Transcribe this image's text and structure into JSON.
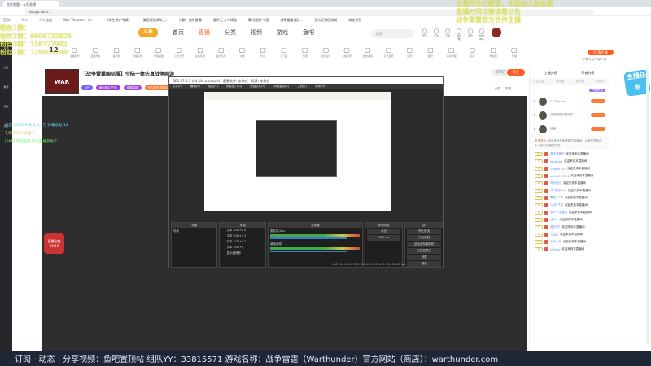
{
  "browser": {
    "tab_title": "战争雷霆 - 斗鱼直播",
    "url": "douyu.com/…",
    "bookmarks": [
      "百科",
      "个人",
      "人人法宝",
      "War Thunder - 六…",
      "《学生用户专属》",
      "美丽优质精华_…",
      "沐鹏 - 战争雷霆",
      "提供无·心中精品",
      "腾讯视频·中国",
      "战争雷霆战区…",
      "官方正宗国游戏",
      "其他书签"
    ]
  },
  "overlay": {
    "left_lines": [
      "粉丝1群：",
      "粉丝2群：6606725826",
      "粉丝3群：158327992",
      "粉丝1群：729803299"
    ],
    "right_lines": [
      "主播开车已解锁，欢迎加入粉丝群",
      "直播时间详情请看公告",
      "战争雷霆官方合作主播"
    ]
  },
  "leftbar": {
    "items": [
      "直播",
      "关注",
      "推荐",
      "游戏",
      "消息"
    ]
  },
  "nav": {
    "logo": "斗鱼",
    "items": [
      "首页",
      "直播",
      "分类",
      "视频",
      "游戏",
      "鱼吧"
    ],
    "search_placeholder": "搜索",
    "top_icons": [
      "历史",
      "关注",
      "下载",
      "客户端",
      "消息",
      "创作中心"
    ]
  },
  "iconrow": {
    "count": "12",
    "items": [
      "主播积分",
      "直播开关",
      "鱼乐圈",
      "主播任务",
      "开播提醒",
      "火力全开",
      "鲨鱼任务",
      "官方任务",
      "礼物",
      "分享",
      "小飞船",
      "乐团",
      "主播任务",
      "主播之家",
      "回放视频",
      "打赏金币",
      "房管",
      "超管",
      "房间管理",
      "互动",
      "粉丝团",
      "开播",
      "更多"
    ],
    "pc_button": "PC客户端",
    "pc_sub": "下载斗鱼PC客户端"
  },
  "stream": {
    "title": "【战争雷霆国际服】空陆一体仿真战争网游",
    "thumb": "WAR THUNDER",
    "tags": [
      "VIP",
      "福利商店 豆券",
      "直播高能",
      "全民助攻 直播活动"
    ],
    "follow_count": "47.9万",
    "follow_label": "关注",
    "share": "分享",
    "report": "举报"
  },
  "stats": {
    "line1": "热度 129289   关注 4.7万   弹幕总数 18",
    "line2": "礼物 1939               贡献 0",
    "line3": "[SKP] 欢迎回来   您的直播开始了"
  },
  "gift": {
    "label": "直播宝箱",
    "count": "20/59"
  },
  "obs": {
    "title": "OBS 27.2.1 (64 bit, windows) - 配置文件: 未命名 - 场景: 未命名",
    "menu": [
      "文件(F)",
      "编辑(E)",
      "视图(V)",
      "停靠窗口(D)",
      "配置文件(P)",
      "场景集合(S)",
      "工具(T)",
      "帮助(H)"
    ],
    "scenes_label": "场景",
    "scene": "场景",
    "sources_label": "来源",
    "sources": [
      "文本 (GDI+) 4",
      "文本 (GDI+) 3",
      "文本 (GDI+) 2",
      "文本 (GDI+)",
      "显示器捕获"
    ],
    "mixer_label": "混音器",
    "mixer": [
      "麦克风/Aux",
      "桌面音频"
    ],
    "transition_label": "转场特效",
    "transition": "淡出",
    "duration": "300 ms",
    "controls_label": "控件",
    "controls": [
      "停止推流",
      "开始录制",
      "启动虚拟摄像机",
      "工作室模式",
      "设置",
      "退出"
    ],
    "status": "LIVE: 00:00:00   REC: 00:00:00   CPU: 1.3%, 60.00 fps"
  },
  "right": {
    "top_links": [
      "上福分榜",
      "荣誉分榜"
    ],
    "tabs": [
      "今日贡献",
      "周贡献",
      "总贡献",
      "贵宾(0)"
    ],
    "open_noble": "开通贵族",
    "ranks": [
      "CCTVarium",
      "深夜撸猫的程序员",
      "逍遥",
      "欢迎"
    ],
    "notice_label": "系统提示:",
    "notice": "欢迎来到战争雷霆的直播间。斗鱼严禁未成年人进行直播或打赏。",
    "messages": [
      {
        "lv": "12",
        "user": "丽宇浩瀚的",
        "text": "欢迎来到本直播间"
      },
      {
        "lv": "17",
        "user": "landing0",
        "text": "欢迎来到本直播间"
      },
      {
        "lv": "17",
        "user": "Ghost5147",
        "text": "欢迎来到本直播间"
      },
      {
        "lv": "12",
        "user": "adfo6997074",
        "text": "欢迎来到本直播间"
      },
      {
        "lv": "10",
        "user": "可乐西瓜",
        "text": "欢迎来到本直播间"
      },
      {
        "lv": "10",
        "user": "开飞机的Fox",
        "text": "欢迎来到本直播间"
      },
      {
        "lv": "18",
        "user": "飘然1729",
        "text": "欢迎来到本直播间"
      },
      {
        "lv": "20",
        "user": "CAPF飞机",
        "text": "欢迎来到本直播间"
      },
      {
        "lv": "11",
        "user": "忠义一生爱国",
        "text": "欢迎来到本直播间"
      },
      {
        "lv": "10",
        "user": "日Fox",
        "text": "欢迎来到本直播间"
      },
      {
        "lv": "17",
        "user": "谁在吃F",
        "text": "欢迎来到本直播间"
      },
      {
        "lv": "11",
        "user": "T-80U",
        "text": "欢迎来到本直播间"
      },
      {
        "lv": "15",
        "user": "小五小鸟",
        "text": "欢迎来到本直播间"
      },
      {
        "lv": "12",
        "user": "Victory",
        "text": "欢迎来到本直播间"
      }
    ],
    "badge": "主播任务"
  },
  "ticker": "订阅 · 动态 · 分享视频：鱼吧置顶帖  组队YY：33815571  游戏名称：战争雷霆（Warthunder）官方网站（商店）：warthunder.com"
}
